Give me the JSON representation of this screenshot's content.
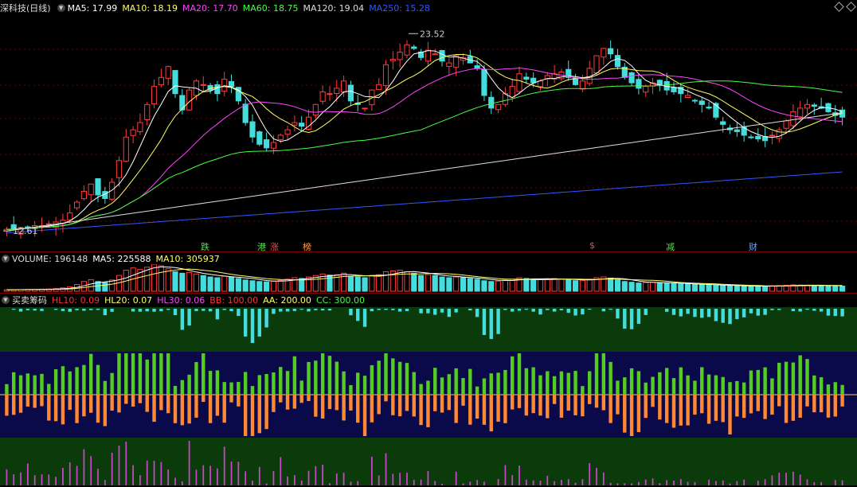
{
  "header": {
    "title": "深科技(日线)",
    "indicators": [
      {
        "label": "MA5: 17.99",
        "color": "#ffffff"
      },
      {
        "label": "MA10: 18.19",
        "color": "#ffff66"
      },
      {
        "label": "MA20: 17.70",
        "color": "#ff44ff"
      },
      {
        "label": "MA60: 18.75",
        "color": "#44ff44"
      },
      {
        "label": "MA120: 19.04",
        "color": "#dddddd"
      },
      {
        "label": "MA250: 15.28",
        "color": "#3355ff"
      }
    ]
  },
  "price_annotations": {
    "high_label": "23.52",
    "low_label": "12.61"
  },
  "events": [
    {
      "text": "跌",
      "color": "#55dd55"
    },
    {
      "text": "港",
      "color": "#55dd55"
    },
    {
      "text": "涨",
      "color": "#ff4444"
    },
    {
      "text": "榜",
      "color": "#ff9944"
    },
    {
      "text": "$",
      "color": "#ff4444"
    },
    {
      "text": "减",
      "color": "#55dd55"
    },
    {
      "text": "财",
      "color": "#66aaff"
    }
  ],
  "volume_header": {
    "title": "VOLUME: 196148",
    "ma5": "MA5: 225588",
    "ma10": "MA10: 305937"
  },
  "chip_header": {
    "title": "买卖筹码",
    "items": [
      {
        "label": "HL10: 0.09",
        "color": "#ff3333"
      },
      {
        "label": "HL20: 0.07",
        "color": "#ffff66"
      },
      {
        "label": "HL30: 0.06",
        "color": "#ff44ff"
      },
      {
        "label": "BB: 100.00",
        "color": "#ff3333"
      },
      {
        "label": "AA: 200.00",
        "color": "#ffff66"
      },
      {
        "label": "CC: 300.00",
        "color": "#44ff44"
      }
    ]
  },
  "chart_data": {
    "type": "candlestick",
    "title": "深科技(日线)",
    "ylim": [
      12.0,
      24.5
    ],
    "high_marker": 23.52,
    "low_marker": 12.61,
    "closes": [
      12.7,
      12.7,
      12.8,
      12.8,
      12.9,
      12.9,
      13.0,
      13.1,
      13.2,
      13.6,
      14.2,
      14.8,
      15.2,
      14.6,
      14.4,
      15.3,
      16.5,
      17.8,
      18.2,
      18.6,
      19.6,
      20.6,
      21.1,
      21.7,
      20.2,
      19.3,
      20.4,
      20.9,
      20.7,
      20.4,
      20.2,
      21.0,
      20.6,
      19.8,
      18.6,
      17.8,
      17.4,
      17.2,
      17.5,
      17.9,
      18.2,
      18.6,
      18.4,
      18.9,
      19.6,
      20.3,
      20.2,
      20.5,
      20.9,
      19.8,
      19.6,
      19.4,
      20.4,
      20.7,
      21.8,
      22.1,
      22.5,
      22.9,
      22.7,
      22.2,
      22.6,
      22.4,
      22.0,
      21.9,
      22.3,
      22.2,
      21.9,
      21.6,
      20.1,
      19.4,
      19.6,
      20.2,
      20.6,
      21.3,
      21.0,
      20.8,
      20.9,
      21.2,
      21.3,
      21.4,
      21.1,
      20.7,
      20.9,
      21.6,
      22.3,
      22.7,
      22.4,
      21.7,
      21.1,
      20.8,
      20.5,
      20.6,
      20.8,
      20.7,
      20.4,
      20.3,
      20.2,
      20.1,
      19.8,
      19.6,
      19.4,
      18.9,
      18.5,
      18.2,
      18.1,
      17.9,
      17.8,
      17.7,
      17.6,
      17.9,
      18.2,
      18.7,
      19.2,
      19.4,
      19.6,
      19.5,
      19.4,
      19.2,
      19.0,
      18.9
    ],
    "moving_averages": [
      {
        "name": "MA5",
        "value": 17.99
      },
      {
        "name": "MA10",
        "value": 18.19
      },
      {
        "name": "MA20",
        "value": 17.7
      },
      {
        "name": "MA60",
        "value": 18.75
      },
      {
        "name": "MA120",
        "value": 19.04
      },
      {
        "name": "MA250",
        "value": 15.28
      }
    ],
    "volume": {
      "last": 196148,
      "ma5": 225588,
      "ma10": 305937,
      "values": [
        40,
        42,
        45,
        48,
        50,
        55,
        60,
        70,
        90,
        120,
        180,
        260,
        310,
        260,
        230,
        300,
        420,
        560,
        620,
        580,
        640,
        720,
        680,
        600,
        520,
        480,
        500,
        460,
        420,
        380,
        360,
        400,
        380,
        340,
        300,
        280,
        260,
        250,
        270,
        290,
        320,
        360,
        340,
        380,
        420,
        460,
        430,
        440,
        480,
        400,
        380,
        360,
        420,
        440,
        520,
        540,
        560,
        520,
        480,
        420,
        440,
        420,
        380,
        360,
        380,
        360,
        340,
        320,
        280,
        260,
        270,
        300,
        320,
        360,
        340,
        320,
        310,
        330,
        340,
        320,
        300,
        280,
        290,
        320,
        360,
        380,
        350,
        300,
        260,
        240,
        220,
        230,
        240,
        230,
        210,
        200,
        200,
        190,
        180,
        170,
        165,
        160,
        150,
        145,
        140,
        138,
        135,
        132,
        130,
        140,
        150,
        160,
        170,
        165,
        160,
        155,
        150,
        145,
        140,
        138
      ]
    },
    "chip": {
      "labels": [
        "HL10",
        "HL20",
        "HL30",
        "BB",
        "AA",
        "CC"
      ],
      "values": [
        0.09,
        0.07,
        0.06,
        100.0,
        200.0,
        300.0
      ]
    }
  }
}
